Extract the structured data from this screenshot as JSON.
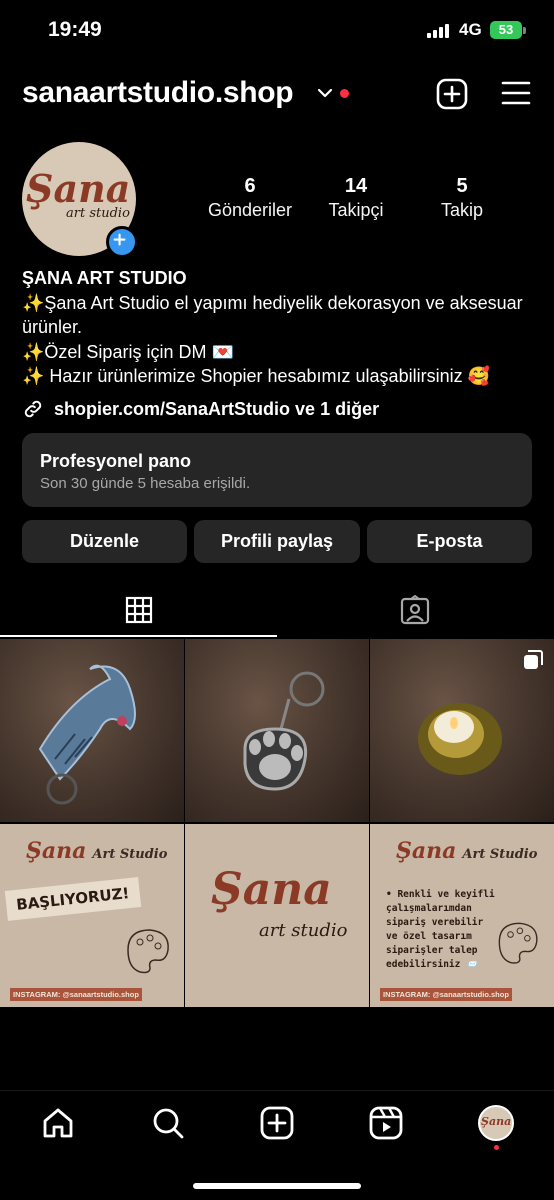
{
  "status": {
    "time": "19:49",
    "network": "4G",
    "battery": "53"
  },
  "header": {
    "username": "sanaartstudio.shop"
  },
  "profile": {
    "avatar_text": "Şana",
    "avatar_sub": "art studio",
    "stats": [
      {
        "value": "6",
        "label": "Gönderiler"
      },
      {
        "value": "14",
        "label": "Takipçi"
      },
      {
        "value": "5",
        "label": "Takip"
      }
    ],
    "name": "ŞANA ART STUDIO",
    "bio_lines": [
      "✨Şana Art Studio el yapımı hediyelik dekorasyon ve aksesuar ürünler.",
      "✨Özel Sipariş için DM 💌",
      "✨ Hazır ürünlerimize Shopier hesabımız ulaşabilirsiniz 🥰"
    ],
    "link": "shopier.com/SanaArtStudio ve 1 diğer"
  },
  "pro_dashboard": {
    "title": "Profesyonel pano",
    "subtitle": "Son 30 günde 5 hesaba erişildi."
  },
  "buttons": {
    "edit": "Düzenle",
    "share": "Profili paylaş",
    "email": "E-posta"
  },
  "posts": {
    "card_brand": "Şana",
    "card_brand_sub": "Art Studio",
    "card_insta": "INSTAGRAM: @sanaartstudio.shop",
    "card_starting": "BAŞLIYORUZ!",
    "card_big": "Şana",
    "card_big_sub": "art studio",
    "card_info": "• Renkli ve keyifli çalışmalarımdan sipariş verebilir ve özel tasarım siparişler talep edebilirsiniz 📨"
  },
  "colors": {
    "accent": "#3797f0",
    "notification": "#ff3040",
    "card_bg": "#262626",
    "battery": "#34c759"
  }
}
